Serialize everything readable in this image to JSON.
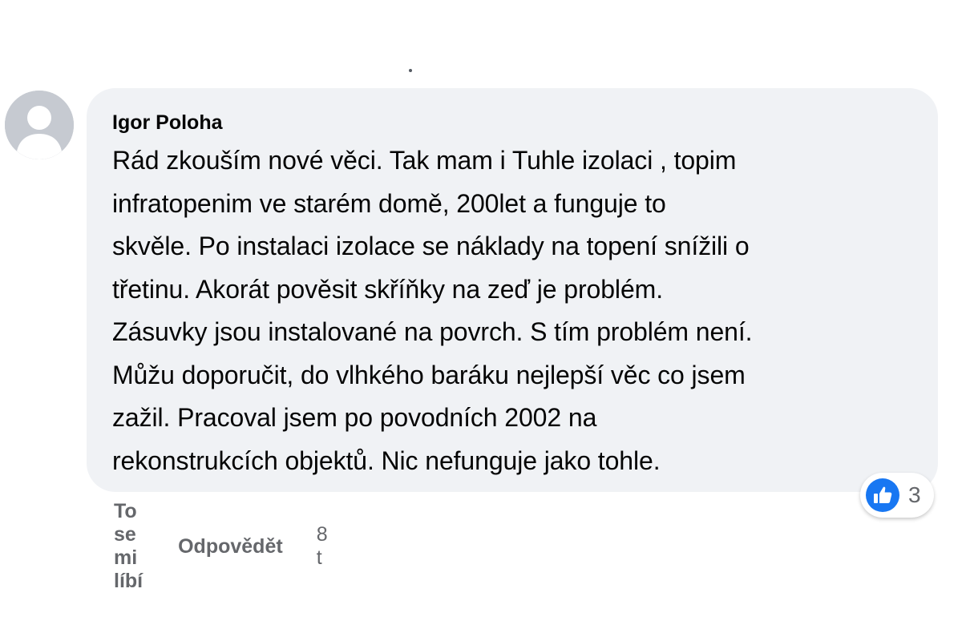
{
  "comment": {
    "author": "Igor Poloha",
    "text": "Rád zkouším nové věci. Tak mam i Tuhle izolaci , topim\ninfratopenim ve starém domě, 200let a funguje to\nskvěle. Po instalaci izolace se náklady na topení snížili o\ntřetinu. Akorát pověsit skříňky na zeď je problém.\nZásuvky jsou instalované na povrch. S tím problém není.\nMůžu doporučit, do vlhkého baráku nejlepší věc co jsem\nzažil. Pracoval jsem po povodních 2002 na\nrekonstrukcích objektů. Nic nefunguje jako tohle.",
    "reactions": {
      "icon": "thumbs-up-icon",
      "count": "3",
      "color": "#1877f2"
    },
    "actions": {
      "like_label": "To se mi líbí",
      "reply_label": "Odpovědět",
      "timestamp": "8 t"
    }
  },
  "colors": {
    "bubble": "#f0f2f5",
    "text": "#050505",
    "secondary_text": "#65676b",
    "avatar_placeholder": "#c6cad1"
  }
}
